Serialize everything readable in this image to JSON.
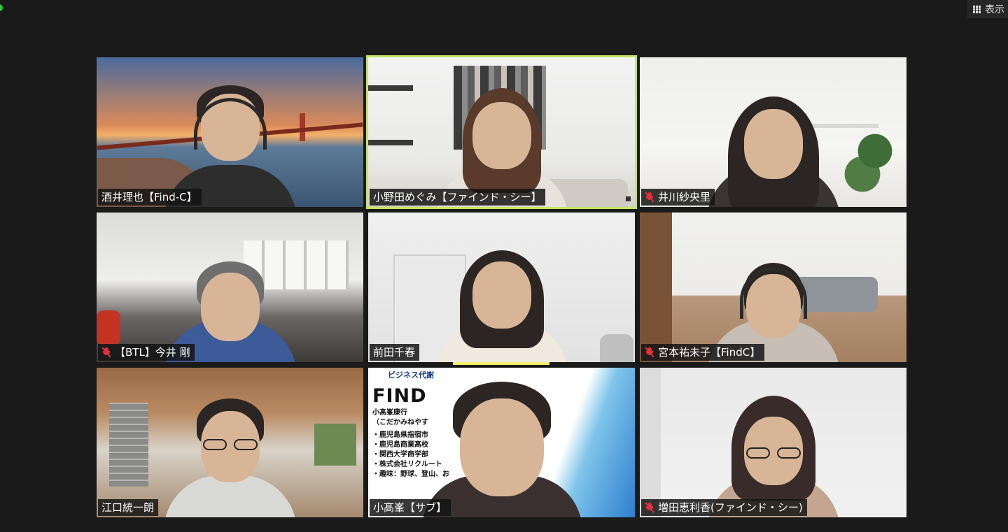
{
  "toolbar": {
    "view_label": "表示"
  },
  "participants": [
    {
      "name": "酒井理也【Find-C】",
      "muted": false,
      "active": false
    },
    {
      "name": "小野田めぐみ【ファインド・シー】",
      "muted": false,
      "active": true
    },
    {
      "name": "井川紗央里",
      "muted": true,
      "active": false
    },
    {
      "name": "【BTL】今井 剛",
      "muted": true,
      "active": false
    },
    {
      "name": "前田千春",
      "muted": false,
      "active": false,
      "speaking": true
    },
    {
      "name": "宮本祐未子【FindC】",
      "muted": true,
      "active": false
    },
    {
      "name": "江口統一朗",
      "muted": false,
      "active": false
    },
    {
      "name": "小髙峯【サブ】",
      "muted": false,
      "active": false
    },
    {
      "name": "増田恵利香(ファインド・シー)",
      "muted": true,
      "active": false
    }
  ],
  "background_card": {
    "company": "ビジネス代謝",
    "find": "FIND",
    "person": "小髙峯康行",
    "reading": "（こだかみねやす",
    "items": [
      "・鹿児島県指宿市",
      "・鹿児島商業高校",
      "・関西大学商学部",
      "・株式会社リクルート",
      "・趣味：野球、登山、お"
    ]
  },
  "colors": {
    "active_border": "#c7e560",
    "speaking_bar": "#f1f06a",
    "mute_red": "#e0313b",
    "background": "#1a1a1a"
  }
}
